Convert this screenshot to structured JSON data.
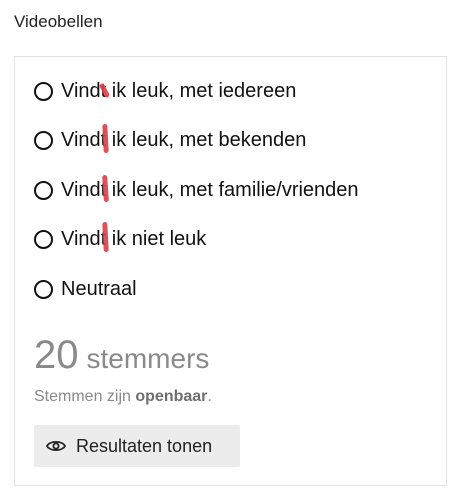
{
  "poll": {
    "title": "Videobellen",
    "options": [
      {
        "label": "Vindt ik leuk, met iedereen"
      },
      {
        "label": "Vindt ik leuk, met bekenden"
      },
      {
        "label": "Vindt ik leuk, met familie/vrienden"
      },
      {
        "label": "Vindt ik niet leuk"
      },
      {
        "label": "Neutraal"
      }
    ],
    "voter_count": "20",
    "voter_unit": "stemmers",
    "visibility_prefix": "Stemmen zijn ",
    "visibility_value": "openbaar",
    "visibility_suffix": ".",
    "show_results_label": "Resultaten tonen"
  },
  "colors": {
    "annotation_mark": "#d9424c",
    "muted_text": "#8a8a8a",
    "button_bg": "#ececec"
  }
}
